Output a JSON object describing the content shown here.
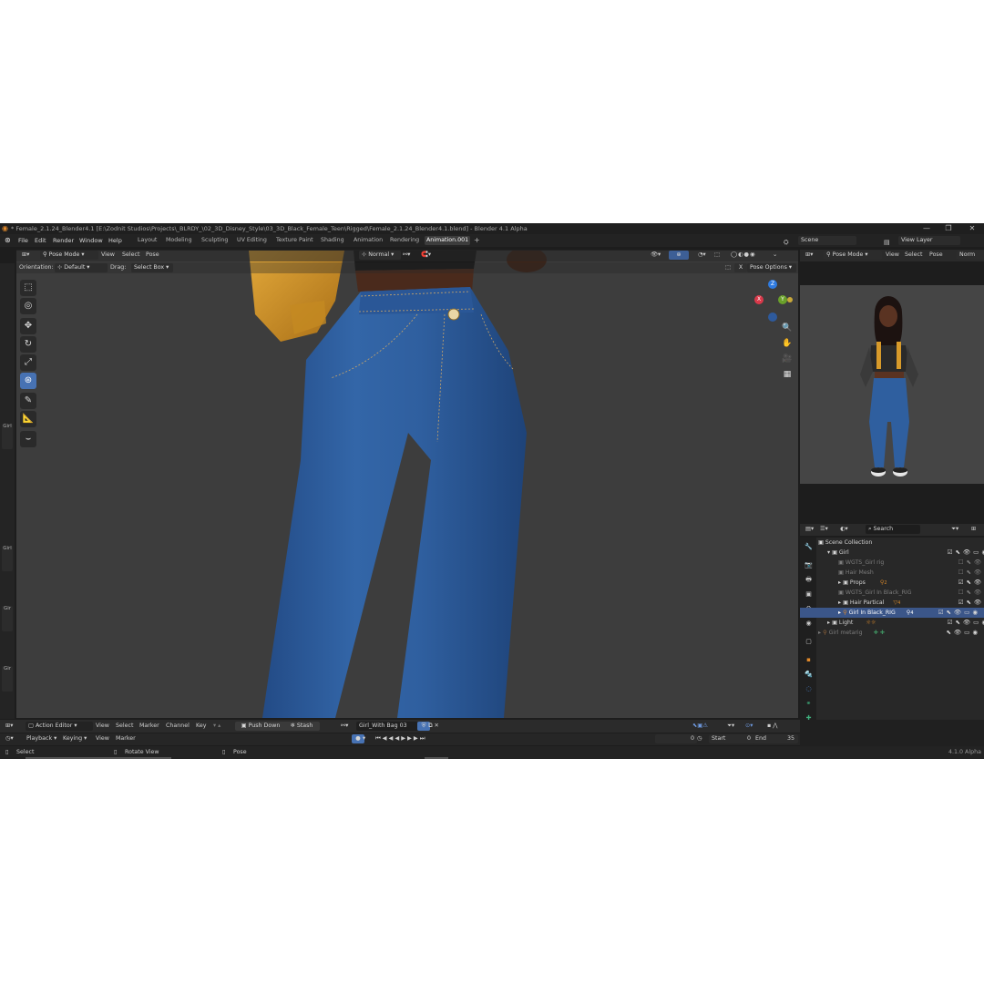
{
  "window": {
    "title": "* Female_2.1.24_Blender4.1 [E:\\Zodnit Studios\\Projects\\_BLRDY_\\02_3D_Disney_Style\\03_3D_Black_Female_Teen\\Rigged\\Female_2.1.24_Blender4.1.blend] - Blender 4.1 Alpha",
    "controls": [
      "—",
      "❐",
      "✕"
    ]
  },
  "menu": [
    "File",
    "Edit",
    "Render",
    "Window",
    "Help"
  ],
  "workspaces": [
    "Layout",
    "Modeling",
    "Sculpting",
    "UV Editing",
    "Texture Paint",
    "Shading",
    "Animation",
    "Rendering",
    "Animation.001"
  ],
  "workspace_add": "+",
  "scene": {
    "label": "Scene",
    "view_layer": "View Layer"
  },
  "viewport": {
    "mode": "Pose Mode",
    "menus": [
      "View",
      "Select",
      "Pose"
    ],
    "transform_orientation": "Normal",
    "orientation_label": "Orientation:",
    "orientation_value": "Default",
    "drag_label": "Drag:",
    "drag_value": "Select Box",
    "pose_options": "Pose Options",
    "x_mirror": "X",
    "gizmo_axes": [
      "Z",
      "Y",
      "X"
    ]
  },
  "preview_header": {
    "mode": "Pose Mode",
    "menus": [
      "View",
      "Select",
      "Pose"
    ],
    "orientation": "Norm"
  },
  "left_tabs": [
    "Girl",
    "Girl",
    "Gir",
    "Gir"
  ],
  "outliner": {
    "search_placeholder": "Search",
    "root": "Scene Collection",
    "rows": [
      {
        "label": "Girl",
        "dim": false,
        "selected": false
      },
      {
        "label": "WGTS_Girl rig",
        "dim": true,
        "selected": false
      },
      {
        "label": "Hair Mesh",
        "dim": true,
        "selected": false
      },
      {
        "label": "Props",
        "dim": false,
        "selected": false,
        "badge": "2"
      },
      {
        "label": "WGTS_Girl In Black_RIG",
        "dim": true,
        "selected": false
      },
      {
        "label": "Hair Partical",
        "dim": false,
        "selected": false,
        "badge": "4"
      },
      {
        "label": "Girl In Black_RIG",
        "dim": false,
        "selected": true,
        "badge": "4"
      },
      {
        "label": "Light",
        "dim": false,
        "selected": false
      },
      {
        "label": "Girl metarig",
        "dim": true,
        "selected": false
      }
    ]
  },
  "action_editor": {
    "editor": "Action Editor",
    "menus": [
      "View",
      "Select",
      "Marker",
      "Channel",
      "Key"
    ],
    "push_down": "Push Down",
    "stash": "Stash",
    "action_name": "Girl_With Bag 03"
  },
  "timeline": {
    "menus": [
      "Playback",
      "Keying",
      "View",
      "Marker"
    ],
    "current_frame": "0",
    "start_label": "Start",
    "start": "0",
    "end_label": "End",
    "end": "35"
  },
  "statusbar": {
    "left": "Select",
    "middle": "Rotate View",
    "right": "Pose",
    "version": "4.1.0 Alpha"
  },
  "colors": {
    "accent": "#4772b3",
    "selected_row": "#3b5689",
    "viewport_bg": "#3d3d3d",
    "denim": "#2d5a9c",
    "bag": "#d79a2a"
  }
}
